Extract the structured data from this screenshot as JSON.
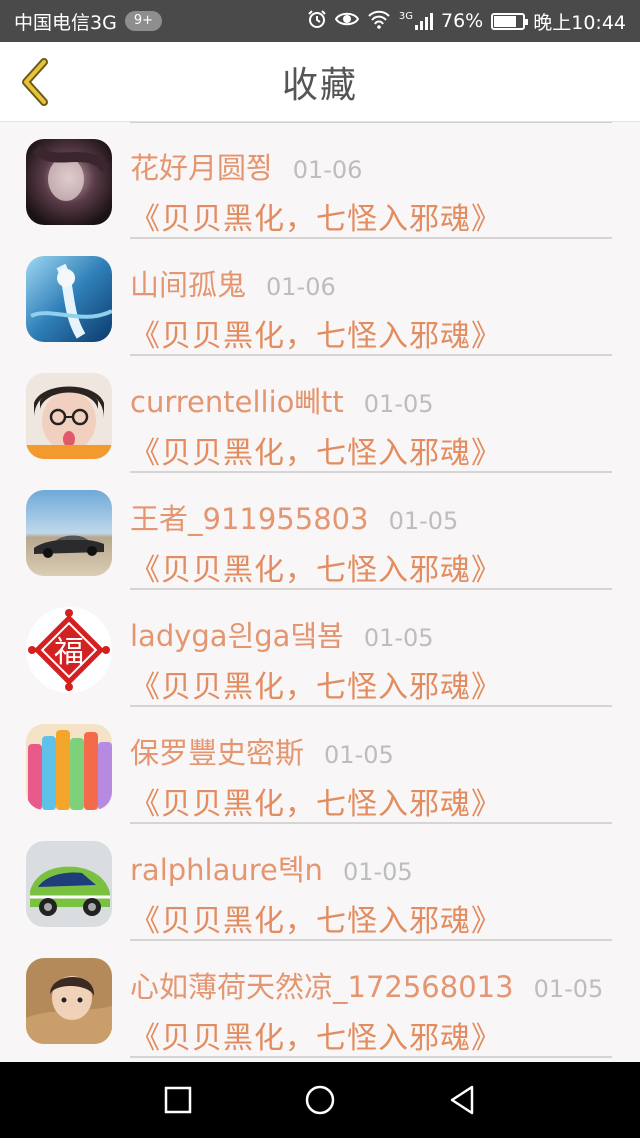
{
  "status_bar": {
    "carrier": "中国电信3G",
    "badge": "9+",
    "net_label": "3G",
    "battery": "76%",
    "time": "晚上10:44",
    "icons": [
      "alarm-icon",
      "eye-icon",
      "wifi-icon",
      "signal-icon",
      "battery-icon"
    ]
  },
  "header": {
    "title": "收藏",
    "back_icon": "chevron-left-icon",
    "accent": "#e8c23a"
  },
  "items": [
    {
      "name": "花好月圆쬥",
      "date": "01-06",
      "post": "《贝贝黑化，七怪入邪魂》",
      "avatar": "avatar-dark-portrait"
    },
    {
      "name": "山间孤鬼",
      "date": "01-06",
      "post": "《贝贝黑化，七怪入邪魂》",
      "avatar": "avatar-anime-blue"
    },
    {
      "name": "currentellio뻬tt",
      "date": "01-05",
      "post": "《贝贝黑化，七怪入邪魂》",
      "avatar": "avatar-girl-glasses"
    },
    {
      "name": "王者_911955803",
      "date": "01-05",
      "post": "《贝贝黑化，七怪入邪魂》",
      "avatar": "avatar-race-car"
    },
    {
      "name": "ladyga읜ga댘뵴",
      "date": "01-05",
      "post": "《贝贝黑化，七怪入邪魂》",
      "avatar": "avatar-fu-character"
    },
    {
      "name": "保罗豐史密斯",
      "date": "01-05",
      "post": "《贝贝黑化，七怪入邪魂》",
      "avatar": "avatar-colorful-bottles"
    },
    {
      "name": "ralphlaure톅n",
      "date": "01-05",
      "post": "《贝贝黑化，七怪入邪魂》",
      "avatar": "avatar-rally-car"
    },
    {
      "name": "心如薄荷天然凉_172568013",
      "date": "01-05",
      "post": "《贝贝黑化，七怪入邪魂》",
      "avatar": "avatar-boy-portrait"
    }
  ],
  "colors": {
    "name": "#e49670",
    "post": "#e28c5f",
    "date": "#bdbdbd",
    "background": "#f8f6f6"
  },
  "nav_bar": {
    "icons": [
      "recent-apps-icon",
      "home-icon",
      "back-triangle-icon"
    ]
  }
}
